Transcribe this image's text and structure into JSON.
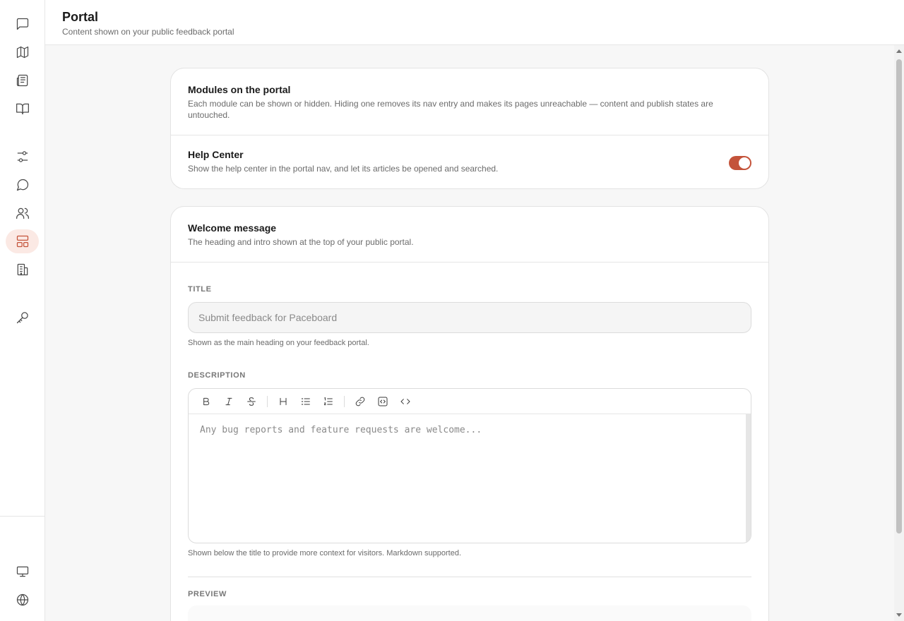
{
  "header": {
    "title": "Portal",
    "subtitle": "Content shown on your public feedback portal"
  },
  "sidebar": {
    "items": [
      {
        "icon": "message-square-icon",
        "active": false
      },
      {
        "icon": "map-icon",
        "active": false
      },
      {
        "icon": "newspaper-icon",
        "active": false
      },
      {
        "icon": "book-open-icon",
        "active": false
      },
      {
        "icon": "sliders-icon",
        "active": false
      },
      {
        "icon": "message-circle-icon",
        "active": false
      },
      {
        "icon": "users-icon",
        "active": false
      },
      {
        "icon": "layout-icon",
        "active": true
      },
      {
        "icon": "building-icon",
        "active": false
      },
      {
        "icon": "key-icon",
        "active": false
      }
    ],
    "footer_items": [
      {
        "icon": "monitor-icon"
      },
      {
        "icon": "globe-icon"
      }
    ]
  },
  "modules": {
    "title": "Modules on the portal",
    "description": "Each module can be shown or hidden. Hiding one removes its nav entry and makes its pages unreachable — content and publish states are untouched.",
    "help_center": {
      "title": "Help Center",
      "description": "Show the help center in the portal nav, and let its articles be opened and searched.",
      "enabled": true
    }
  },
  "welcome": {
    "title": "Welcome message",
    "description": "The heading and intro shown at the top of your public portal.",
    "title_field": {
      "label": "TITLE",
      "placeholder": "Submit feedback for Paceboard",
      "hint": "Shown as the main heading on your feedback portal."
    },
    "description_field": {
      "label": "DESCRIPTION",
      "placeholder": "Any bug reports and feature requests are welcome...",
      "hint": "Shown below the title to provide more context for visitors. Markdown supported.",
      "toolbar": [
        "bold-icon",
        "italic-icon",
        "strikethrough-icon",
        "heading-icon",
        "bullet-list-icon",
        "numbered-list-icon",
        "link-icon",
        "code-block-icon",
        "code-icon"
      ]
    },
    "preview_label": "PREVIEW"
  },
  "colors": {
    "accent": "#c4533a",
    "accent_soft": "#fbe9e4"
  }
}
